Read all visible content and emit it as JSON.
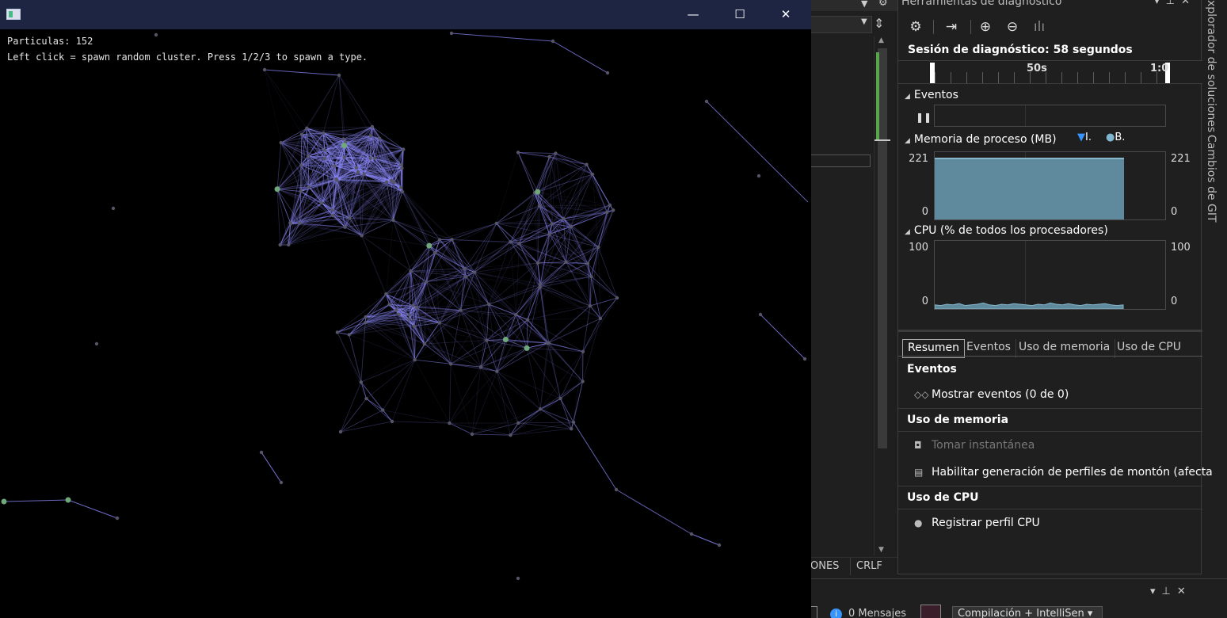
{
  "app": {
    "particles_label": "Particulas: 152",
    "instructions": "Left click = spawn random cluster. Press 1/2/3 to spawn a type.",
    "colors": {
      "edge": "#8f8cff",
      "node_green": "#6fa87a",
      "node_gray": "#555566"
    }
  },
  "vs": {
    "status_ones": "ONES",
    "status_crlf": "CRLF"
  },
  "diag": {
    "title": "Herramientas de diagnóstico",
    "session": "Sesión de diagnóstico: 58 segundos",
    "ruler_50": "50s",
    "ruler_1": "1:0",
    "events_header": "Eventos",
    "memory_header": "Memoria de proceso (MB)",
    "memory_legend_1": "I.",
    "memory_legend_2": "B.",
    "memory_max": "221",
    "memory_min": "0",
    "memory_level": 1.0,
    "cpu_header": "CPU (% de todos los procesadores)",
    "cpu_max": "100",
    "cpu_min": "0",
    "cpu_values": [
      4,
      3,
      5,
      4,
      6,
      3,
      4,
      5,
      7,
      4,
      3,
      5,
      4,
      6,
      5,
      4,
      3,
      5,
      4,
      7,
      5,
      4,
      6,
      4,
      3,
      5,
      4,
      5,
      6,
      4,
      3,
      4
    ],
    "tabs": [
      "Resumen",
      "Eventos",
      "Uso de memoria",
      "Uso de CPU"
    ],
    "summary": {
      "events_h": "Eventos",
      "show_events": "Mostrar eventos (0 de 0)",
      "memory_h": "Uso de memoria",
      "snapshot": "Tomar instantánea",
      "heap": "Habilitar generación de perfiles de montón (afecta",
      "cpu_h": "Uso de CPU",
      "record_cpu": "Registrar perfil CPU"
    }
  },
  "side_tabs": {
    "solution": "xplorador de soluciones",
    "git": "Cambios de GIT"
  },
  "bottom": {
    "messages": "0 Mensajes",
    "build_combo": "Compilación + IntelliSen"
  }
}
